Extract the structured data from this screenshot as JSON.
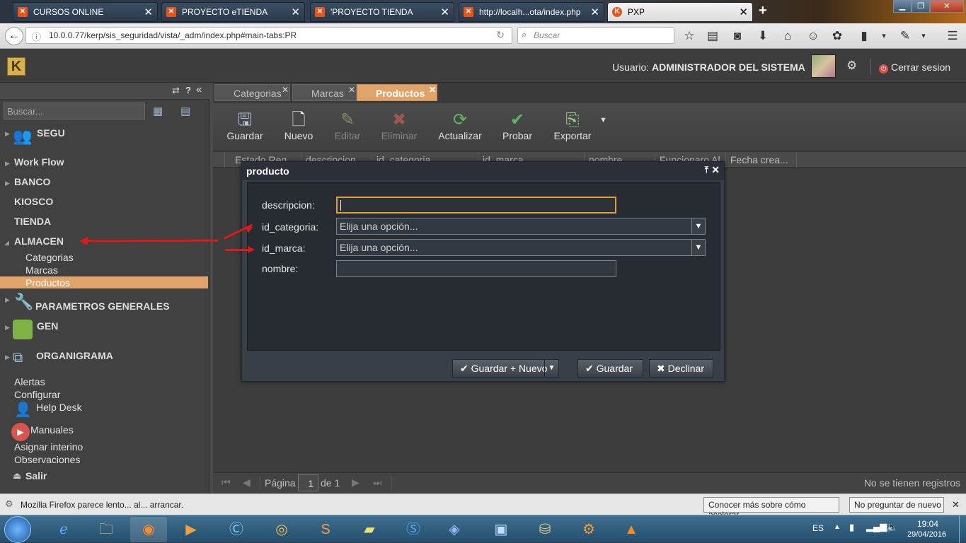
{
  "browser": {
    "tabs": [
      {
        "label": "CURSOS ONLINE",
        "active": false
      },
      {
        "label": "PROYECTO eTIENDA",
        "active": false
      },
      {
        "label": "'PROYECTO TIENDA",
        "active": false
      },
      {
        "label": "http://localh...ota/index.php",
        "active": false
      },
      {
        "label": "PXP",
        "active": true
      }
    ],
    "new_tab": "+",
    "url": "10.0.0.77/kerp/sis_seguridad/vista/_adm/index.php#main-tabs:PR",
    "search_placeholder": "Buscar"
  },
  "header": {
    "user_label": "Usuario:",
    "user_name": "ADMINISTRADOR DEL SISTEMA",
    "logout": "Cerrar sesion"
  },
  "sidebar": {
    "search_placeholder": "Buscar...",
    "items": [
      {
        "label": "SEGU"
      },
      {
        "label": "Work Flow"
      },
      {
        "label": "BANCO"
      },
      {
        "label": "KIOSCO"
      },
      {
        "label": "TIENDA"
      },
      {
        "label": "ALMACEN"
      },
      {
        "label": "PARAMETROS GENERALES"
      },
      {
        "label": "GEN"
      },
      {
        "label": "ORGANIGRAMA"
      }
    ],
    "almacen_children": [
      "Categorias",
      "Marcas",
      "Productos"
    ],
    "extras": [
      "Alertas",
      "Configurar",
      "Help Desk",
      "Manuales",
      "Asignar interino",
      "Observaciones",
      "Salir"
    ]
  },
  "main": {
    "tabs": [
      "Categorias",
      "Marcas",
      "Productos"
    ],
    "toolbar": [
      "Guardar",
      "Nuevo",
      "Editar",
      "Eliminar",
      "Actualizar",
      "Probar",
      "Exportar"
    ],
    "columns": [
      "Estado Reg.",
      "descripcion",
      "id_categoria",
      "id_marca",
      "nombre",
      "Funcionaro Al",
      "Fecha crea..."
    ],
    "pager": {
      "page_label": "Página",
      "page": "1",
      "of_label": "de 1",
      "empty": "No se tienen registros"
    }
  },
  "dialog": {
    "title": "producto",
    "fields": [
      {
        "label": "descripcion:",
        "value": ""
      },
      {
        "label": "id_categoria:",
        "value": "Elija una opción..."
      },
      {
        "label": "id_marca:",
        "value": "Elija una opción..."
      },
      {
        "label": "nombre:",
        "value": ""
      }
    ],
    "buttons": {
      "save_new": "Guardar + Nuevo",
      "save": "Guardar",
      "decline": "Declinar"
    }
  },
  "status": {
    "message": "Mozilla Firefox parece lento... al... arrancar.",
    "learn_more": "Conocer más sobre cómo acelerar",
    "dont_ask": "No preguntar de nuevo"
  },
  "taskbar": {
    "lang": "ES",
    "time": "19:04",
    "date": "29/04/2016"
  },
  "colors": {
    "accent": "#e0a36a",
    "focus": "#e39c3c",
    "annotation": "#e01818"
  }
}
